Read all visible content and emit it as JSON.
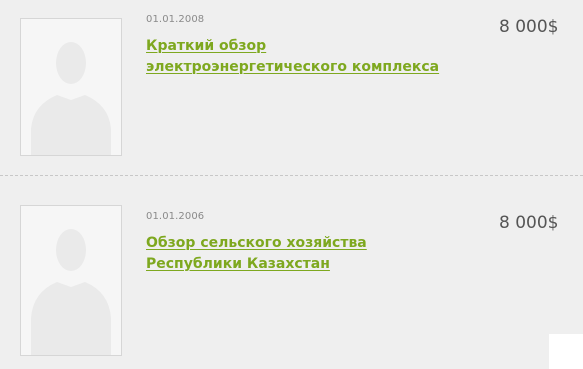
{
  "items": [
    {
      "date": "01.01.2008",
      "title": "Краткий обзор электроэнергетического комплекса",
      "price": "8 000$",
      "thumbnail_icon": "user-placeholder-icon"
    },
    {
      "date": "01.01.2006",
      "title": "Обзор сельского хозяйства Республики Казахстан",
      "price": "8 000$",
      "thumbnail_icon": "user-placeholder-icon"
    }
  ],
  "colors": {
    "background": "#efefef",
    "title_link": "#7ea81f",
    "date_text": "#8a8a8a",
    "price_text": "#555555",
    "separator": "#c7c7c7"
  }
}
